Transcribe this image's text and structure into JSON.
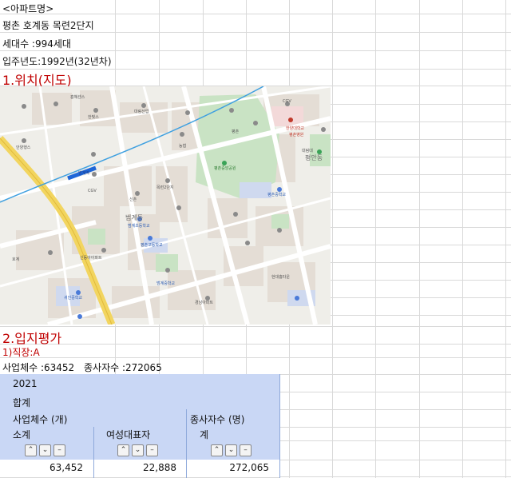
{
  "sheet": {
    "header_label": "<아파트명>",
    "apt_name": "평촌 호계동 목련2단지",
    "households": "세대수 :994세대",
    "year_built": "입주년도:1992년(32년차)",
    "section1_title": "1.위치(지도)",
    "section2_title": "2.입지평가",
    "sub1_title": "1)직장:A",
    "business_count": "사업체수 :63452",
    "employee_count": "종사자수 :272065"
  },
  "map": {
    "labels": {
      "hwadong": "흥혜센스",
      "hanbit": "한빛스",
      "daelim": "대림산업",
      "anyang": "안양행스",
      "nong": "농협",
      "cgv1": "CGV",
      "cgv2": "CGV",
      "pyeongchon_station": "평촌",
      "beomgye_station": "범계역",
      "beomgye": "범계동",
      "pyeongan": "평안동",
      "pyeongchon_park": "평촌중앙공원",
      "sinchon": "신촌",
      "mokryeon": "목련2단지",
      "hanyang": "한양대학교",
      "hospital": "평촌병원",
      "daelim_univ": "대림대",
      "hogye": "호계",
      "hyeonde": "현대홈타운",
      "gwamyeong": "경남아파트",
      "beomgye_elem": "범계초등학교",
      "beomgye_middle": "범계중학교",
      "pyeongchon_middle": "평촌중학교",
      "pyeongchon_high": "평촌고등학교",
      "gwiin": "귀인중학교",
      "sinchon_apt": "신동아아파트"
    }
  },
  "pivot": {
    "year": "2021",
    "total_label": "합계",
    "col_business": "사업체수 (개)",
    "col_employee": "종사자수 (명)",
    "sub_subtotal": "소계",
    "sub_female": "여성대표자",
    "sub_total": "계",
    "val_business": "63,452",
    "val_female": "22,888",
    "val_employee": "272,065"
  },
  "colors": {
    "accent_red": "#c00000",
    "pivot_header": "#c9d7f5",
    "grid_line": "#d9d9d9"
  }
}
